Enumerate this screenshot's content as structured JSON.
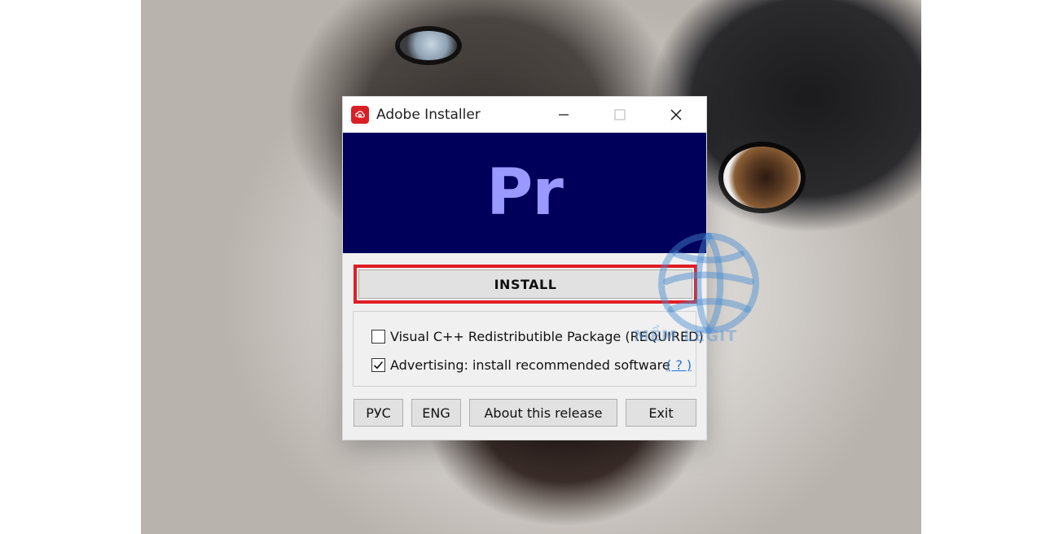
{
  "window": {
    "title": "Adobe Installer",
    "app_icon": "adobe-creative-cloud-icon",
    "controls": {
      "minimize": "minimize-icon",
      "maximize": "maximize-icon",
      "close": "close-icon"
    }
  },
  "banner": {
    "logo_text": "Pr",
    "background": "#00005b",
    "logo_color": "#9999ff"
  },
  "install": {
    "label": "INSTALL",
    "highlight_color": "#e11e24"
  },
  "options": [
    {
      "label": "Visual C++ Redistributible Package (REQUIRED)",
      "checked": false
    },
    {
      "label": "Advertising: install recommended software",
      "checked": true
    }
  ],
  "help_link": "( ? )",
  "buttons": {
    "rus": "РУС",
    "eng": "ENG",
    "about": "About this release",
    "exit": "Exit"
  },
  "watermark": {
    "text": "MỀM LEGIT",
    "color": "#5a96d2"
  }
}
